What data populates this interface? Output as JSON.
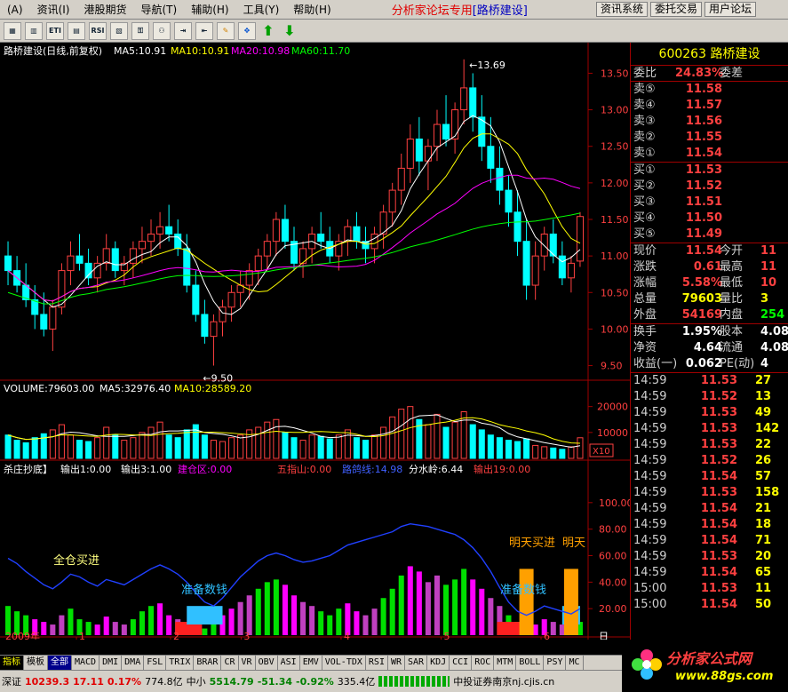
{
  "menu": {
    "items": [
      "(A)",
      "资讯(I)",
      "港股期货",
      "导航(T)",
      "辅助(H)",
      "工具(Y)",
      "帮助(H)"
    ],
    "center_title": "分析家论坛专用",
    "center_stock": "[路桥建设]",
    "right_buttons": [
      "资讯系统",
      "委托交易",
      "用户论坛"
    ]
  },
  "toolbar": {
    "icons": [
      "list-icon",
      "chart-icon",
      "eti-icon",
      "vol-icon",
      "rsi-icon",
      "chart2-icon",
      "key-icon",
      "link-icon",
      "import-icon",
      "export-icon",
      "pencil-icon",
      "move-icon",
      "up-arrow-icon",
      "down-arrow-icon"
    ],
    "labels": [
      "▦",
      "▥",
      "ETI",
      "▤",
      "RSI",
      "▧",
      "⚿",
      "⚇",
      "⇥",
      "⇤",
      "✎",
      "✥",
      "⬆",
      "⬇"
    ]
  },
  "price_panel": {
    "header": {
      "name": "路桥建设(日线,前复权)",
      "ma5": "MA5:10.91",
      "ma10": "MA10:10.91",
      "ma20": "MA20:10.98",
      "ma60": "MA60:11.70"
    },
    "y_ticks": [
      "13.50",
      "13.00",
      "12.50",
      "12.00",
      "11.50",
      "11.00",
      "10.50",
      "10.00",
      "9.50"
    ],
    "high_label": "13.69",
    "low_label": "9.50"
  },
  "volume_panel": {
    "header": {
      "name": "VOLUME:79603.00",
      "ma5": "MA5:32976.40",
      "ma10": "MA10:28589.20"
    },
    "y_ticks": [
      "20000",
      "10000"
    ],
    "unit": "X10"
  },
  "indicator_panel": {
    "header": {
      "name": "杀庄抄底】",
      "out1": "输出1:0.00",
      "out3": "输出3:1.00",
      "jiancang": "建仓区:0.00",
      "wuzhishan": "五指山:0.00",
      "lujing": "路鸽线:14.98",
      "fenshuiling": "分水岭:6.44",
      "out19": "输出19:0.00"
    },
    "y_ticks": [
      "100.00",
      "80.00",
      "60.00",
      "40.00",
      "20.00"
    ],
    "annotations": {
      "buy_full": "全仓买进",
      "prepare_money": "准备数钱",
      "prepare_money2": "准备数钱",
      "buy_tomorrow": "明天买进",
      "buy_tomorrow2": "明天"
    }
  },
  "x_axis": {
    "year": "2009年",
    "months": [
      "1",
      "2",
      "3",
      "4",
      "5",
      "6"
    ],
    "period": "日"
  },
  "quote": {
    "code": "600263",
    "name": "路桥建设",
    "weibi_label": "委比",
    "weibi": "24.83%",
    "weicha_label": "委差",
    "asks": [
      {
        "label": "卖⑤",
        "price": "11.58"
      },
      {
        "label": "卖④",
        "price": "11.57"
      },
      {
        "label": "卖③",
        "price": "11.56"
      },
      {
        "label": "卖②",
        "price": "11.55"
      },
      {
        "label": "卖①",
        "price": "11.54"
      }
    ],
    "bids": [
      {
        "label": "买①",
        "price": "11.53"
      },
      {
        "label": "买②",
        "price": "11.52"
      },
      {
        "label": "买③",
        "price": "11.51"
      },
      {
        "label": "买④",
        "price": "11.50"
      },
      {
        "label": "买⑤",
        "price": "11.49"
      }
    ],
    "stats1": [
      {
        "l1": "现价",
        "v1": "11.54",
        "l2": "今开",
        "v2": "11"
      },
      {
        "l1": "涨跌",
        "v1": "0.61",
        "l2": "最高",
        "v2": "11"
      },
      {
        "l1": "涨幅",
        "v1": "5.58%",
        "l2": "最低",
        "v2": "10"
      },
      {
        "l1": "总量",
        "v1": "79603",
        "l2": "量比",
        "v2": "3"
      },
      {
        "l1": "外盘",
        "v1": "54169",
        "l2": "内盘",
        "v2": "254"
      }
    ],
    "stats2": [
      {
        "l1": "换手",
        "v1": "1.95%",
        "l2": "股本",
        "v2": "4.08"
      },
      {
        "l1": "净资",
        "v1": "4.64",
        "l2": "流通",
        "v2": "4.08"
      },
      {
        "l1": "收益(一)",
        "v1": "0.062",
        "l2": "PE(动)",
        "v2": "4"
      }
    ],
    "ticks": [
      {
        "time": "14:59",
        "price": "11.53",
        "vol": "27"
      },
      {
        "time": "14:59",
        "price": "11.52",
        "vol": "13"
      },
      {
        "time": "14:59",
        "price": "11.53",
        "vol": "49"
      },
      {
        "time": "14:59",
        "price": "11.53",
        "vol": "142"
      },
      {
        "time": "14:59",
        "price": "11.53",
        "vol": "22"
      },
      {
        "time": "14:59",
        "price": "11.52",
        "vol": "26"
      },
      {
        "time": "14:59",
        "price": "11.54",
        "vol": "57"
      },
      {
        "time": "14:59",
        "price": "11.53",
        "vol": "158"
      },
      {
        "time": "14:59",
        "price": "11.54",
        "vol": "21"
      },
      {
        "time": "14:59",
        "price": "11.54",
        "vol": "18"
      },
      {
        "time": "14:59",
        "price": "11.54",
        "vol": "71"
      },
      {
        "time": "14:59",
        "price": "11.53",
        "vol": "20"
      },
      {
        "time": "14:59",
        "price": "11.54",
        "vol": "65"
      },
      {
        "time": "15:00",
        "price": "11.53",
        "vol": "11"
      },
      {
        "time": "15:00",
        "price": "11.54",
        "vol": "50"
      }
    ]
  },
  "tabs": [
    "指标",
    "模板",
    "全部",
    "MACD",
    "DMI",
    "DMA",
    "FSL",
    "TRIX",
    "BRAR",
    "CR",
    "VR",
    "OBV",
    "ASI",
    "EMV",
    "VOL-TDX",
    "RSI",
    "WR",
    "SAR",
    "KDJ",
    "CCI",
    "ROC",
    "MTM",
    "BOLL",
    "PSY",
    "MC"
  ],
  "status": {
    "sz_label": "深证",
    "sz_index": "10239.3",
    "sz_change": "17.11",
    "sz_pct": "0.17%",
    "sz_amount": "774.8亿",
    "zx_label": "中小",
    "zx_index": "5514.79",
    "zx_change": "-51.34",
    "zx_pct": "-0.92%",
    "zx_amount": "335.4亿",
    "broker": "中投证券南京nj.cjis.cn"
  },
  "logo": {
    "name": "分析家公式网",
    "url": "www.88gs.com"
  },
  "chart_data": {
    "type": "candlestick",
    "price_range": [
      9.3,
      13.7
    ],
    "candles": [
      [
        11.0,
        11.2,
        10.6,
        10.8
      ],
      [
        10.8,
        11.0,
        10.5,
        10.6
      ],
      [
        10.6,
        10.9,
        10.3,
        10.4
      ],
      [
        10.4,
        10.6,
        10.0,
        10.2
      ],
      [
        10.2,
        10.5,
        9.9,
        10.0
      ],
      [
        10.0,
        10.4,
        9.7,
        10.3
      ],
      [
        10.3,
        10.9,
        10.2,
        10.8
      ],
      [
        10.8,
        11.2,
        10.6,
        11.0
      ],
      [
        11.0,
        11.3,
        10.8,
        10.9
      ],
      [
        10.9,
        11.1,
        10.6,
        10.7
      ],
      [
        10.7,
        11.0,
        10.5,
        10.9
      ],
      [
        10.9,
        11.3,
        10.8,
        11.1
      ],
      [
        11.1,
        11.2,
        10.7,
        10.8
      ],
      [
        10.8,
        11.0,
        10.6,
        10.9
      ],
      [
        10.9,
        11.2,
        10.7,
        11.1
      ],
      [
        11.1,
        11.4,
        10.9,
        11.2
      ],
      [
        11.2,
        11.5,
        11.0,
        11.3
      ],
      [
        11.3,
        11.6,
        11.1,
        11.4
      ],
      [
        11.4,
        11.7,
        11.2,
        11.3
      ],
      [
        11.3,
        11.5,
        11.0,
        11.1
      ],
      [
        11.1,
        11.3,
        10.5,
        10.6
      ],
      [
        10.6,
        10.8,
        10.1,
        10.2
      ],
      [
        10.2,
        10.4,
        9.8,
        9.9
      ],
      [
        9.9,
        10.2,
        9.5,
        10.1
      ],
      [
        10.1,
        10.4,
        9.9,
        10.3
      ],
      [
        10.3,
        10.6,
        10.1,
        10.5
      ],
      [
        10.5,
        10.8,
        10.3,
        10.6
      ],
      [
        10.6,
        10.9,
        10.4,
        10.8
      ],
      [
        10.8,
        11.1,
        10.6,
        11.0
      ],
      [
        11.0,
        11.3,
        10.8,
        11.2
      ],
      [
        11.2,
        11.6,
        11.0,
        11.5
      ],
      [
        11.5,
        11.7,
        11.1,
        11.2
      ],
      [
        11.2,
        11.4,
        10.8,
        10.9
      ],
      [
        10.9,
        11.2,
        10.7,
        11.1
      ],
      [
        11.1,
        11.4,
        10.9,
        11.3
      ],
      [
        11.3,
        11.6,
        11.1,
        11.2
      ],
      [
        11.2,
        11.4,
        10.9,
        11.0
      ],
      [
        11.0,
        11.3,
        10.8,
        11.2
      ],
      [
        11.2,
        11.5,
        11.0,
        11.4
      ],
      [
        11.4,
        11.6,
        11.1,
        11.2
      ],
      [
        11.2,
        11.4,
        10.9,
        11.1
      ],
      [
        11.1,
        11.4,
        10.9,
        11.3
      ],
      [
        11.3,
        11.7,
        11.1,
        11.6
      ],
      [
        11.6,
        12.0,
        11.4,
        11.9
      ],
      [
        11.9,
        12.4,
        11.7,
        12.2
      ],
      [
        12.2,
        12.8,
        12.0,
        12.6
      ],
      [
        12.6,
        12.9,
        12.1,
        12.3
      ],
      [
        12.3,
        12.6,
        11.9,
        12.5
      ],
      [
        12.5,
        13.0,
        12.3,
        12.8
      ],
      [
        12.8,
        13.2,
        12.5,
        12.6
      ],
      [
        12.6,
        13.1,
        12.4,
        13.0
      ],
      [
        13.0,
        13.69,
        12.8,
        13.3
      ],
      [
        13.3,
        13.5,
        12.7,
        12.9
      ],
      [
        12.9,
        13.2,
        12.3,
        12.5
      ],
      [
        12.5,
        12.9,
        12.0,
        12.2
      ],
      [
        12.2,
        12.5,
        11.7,
        11.9
      ],
      [
        11.9,
        12.1,
        11.4,
        11.6
      ],
      [
        11.6,
        11.9,
        11.0,
        11.2
      ],
      [
        11.2,
        11.5,
        10.4,
        10.6
      ],
      [
        10.6,
        11.2,
        10.4,
        11.0
      ],
      [
        11.0,
        11.4,
        10.8,
        11.3
      ],
      [
        11.3,
        11.5,
        10.9,
        11.0
      ],
      [
        11.0,
        11.2,
        10.6,
        10.7
      ],
      [
        10.7,
        11.0,
        10.5,
        10.9
      ],
      [
        10.93,
        11.6,
        10.85,
        11.54
      ]
    ],
    "volume_max": 24000,
    "volumes": [
      9000,
      7000,
      6000,
      8000,
      9500,
      11000,
      13000,
      9000,
      7000,
      6500,
      8000,
      12000,
      9000,
      7000,
      8000,
      10000,
      12000,
      14000,
      9000,
      8000,
      11000,
      13000,
      9000,
      7000,
      6500,
      8000,
      9000,
      11000,
      12000,
      14000,
      15000,
      10000,
      8000,
      7000,
      9000,
      8500,
      7500,
      9000,
      11000,
      8000,
      7000,
      9000,
      12000,
      16000,
      19000,
      20000,
      15000,
      13000,
      17000,
      12000,
      14000,
      18000,
      13000,
      11000,
      9000,
      8000,
      7000,
      6500,
      7500,
      5000,
      4500,
      4000,
      3500,
      4500,
      7960
    ],
    "indicator_bars": [
      22,
      18,
      15,
      12,
      10,
      8,
      15,
      20,
      12,
      10,
      8,
      14,
      10,
      8,
      12,
      18,
      22,
      24,
      15,
      12,
      8,
      6,
      5,
      10,
      15,
      20,
      25,
      30,
      35,
      40,
      42,
      38,
      30,
      25,
      22,
      18,
      15,
      20,
      24,
      18,
      15,
      20,
      28,
      35,
      45,
      52,
      48,
      40,
      45,
      38,
      42,
      50,
      42,
      35,
      28,
      22,
      15,
      10,
      6,
      8,
      12,
      10,
      8,
      6,
      10
    ],
    "indicator_line": [
      58,
      54,
      48,
      43,
      38,
      35,
      40,
      46,
      44,
      40,
      37,
      42,
      40,
      38,
      42,
      46,
      50,
      53,
      50,
      46,
      40,
      32,
      25,
      22,
      28,
      36,
      44,
      50,
      56,
      60,
      62,
      60,
      57,
      55,
      56,
      58,
      60,
      64,
      68,
      70,
      72,
      74,
      76,
      78,
      82,
      84,
      83,
      82,
      80,
      78,
      76,
      72,
      66,
      58,
      48,
      36,
      25,
      18,
      15,
      18,
      22,
      20,
      18,
      16,
      20
    ]
  }
}
